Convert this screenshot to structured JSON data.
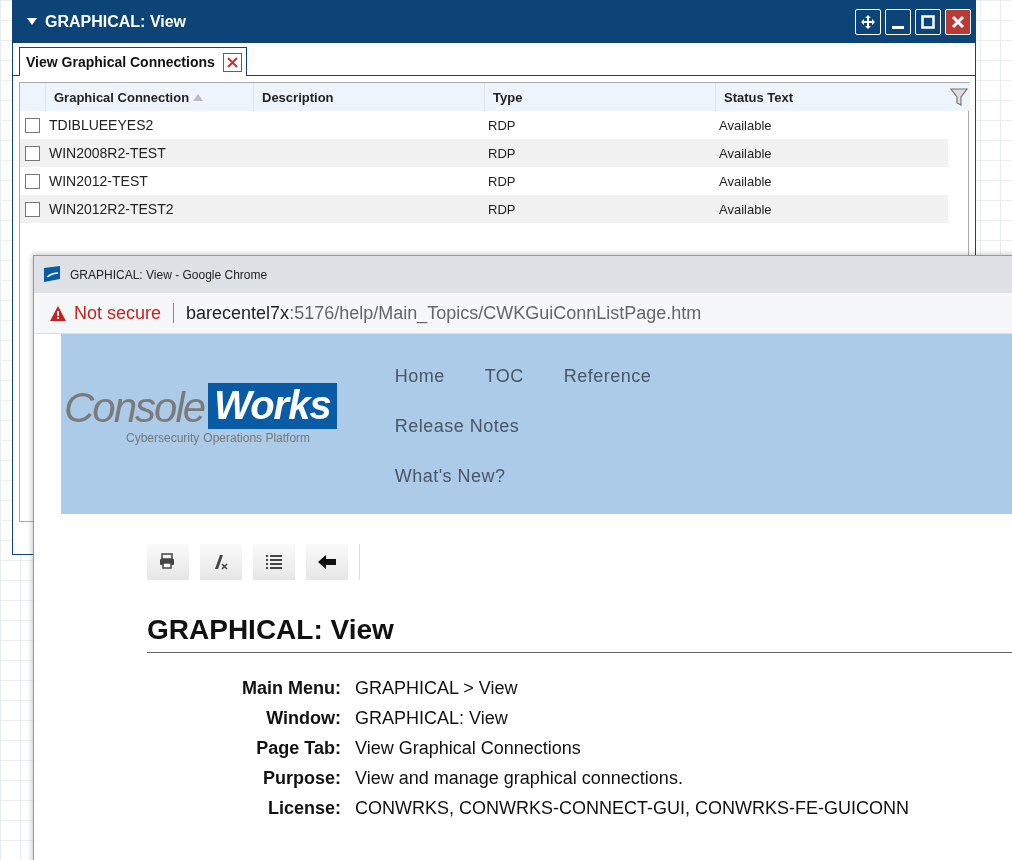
{
  "back_window": {
    "title": "GRAPHICAL: View",
    "tabs": [
      {
        "label": "View Graphical Connections",
        "selected": true
      }
    ],
    "table": {
      "columns": [
        {
          "label": "Graphical Connection",
          "sorted": true
        },
        {
          "label": "Description",
          "sorted": false
        },
        {
          "label": "Type",
          "sorted": false
        },
        {
          "label": "Status Text",
          "sorted": false
        }
      ],
      "rows": [
        {
          "checked": false,
          "name": "TDIBLUEEYES2",
          "type": "RDP",
          "status": "Available"
        },
        {
          "checked": false,
          "name": "WIN2008R2-TEST",
          "type": "RDP",
          "status": "Available"
        },
        {
          "checked": false,
          "name": "WIN2012-TEST",
          "type": "RDP",
          "status": "Available"
        },
        {
          "checked": false,
          "name": "WIN2012R2-TEST2",
          "type": "RDP",
          "status": "Available"
        }
      ]
    }
  },
  "browser": {
    "title": "GRAPHICAL: View - Google Chrome",
    "security": "Not secure",
    "url_host": "barecentel7x",
    "url_path": ":5176/help/Main_Topics/CWKGuiConnListPage.htm",
    "page": {
      "logo": {
        "word_1": "Console",
        "word_2": "Works",
        "tagline_1": "Cybersecurity",
        "tagline_2": "Operations Platform"
      },
      "nav": [
        "Home",
        "TOC",
        "Reference",
        "Release Notes",
        "What's New?"
      ],
      "heading": "GRAPHICAL: View",
      "facts": [
        {
          "label": "Main Menu:",
          "value": "GRAPHICAL > View"
        },
        {
          "label": "Window:",
          "value": "GRAPHICAL: View"
        },
        {
          "label": "Page Tab:",
          "value": "View Graphical Connections"
        },
        {
          "label": "Purpose:",
          "value": "View and manage graphical connections."
        },
        {
          "label": "License:",
          "value": "CONWRKS, CONWRKS-CONNECT-GUI, CONWRKS-FE-GUICONN"
        }
      ]
    }
  }
}
